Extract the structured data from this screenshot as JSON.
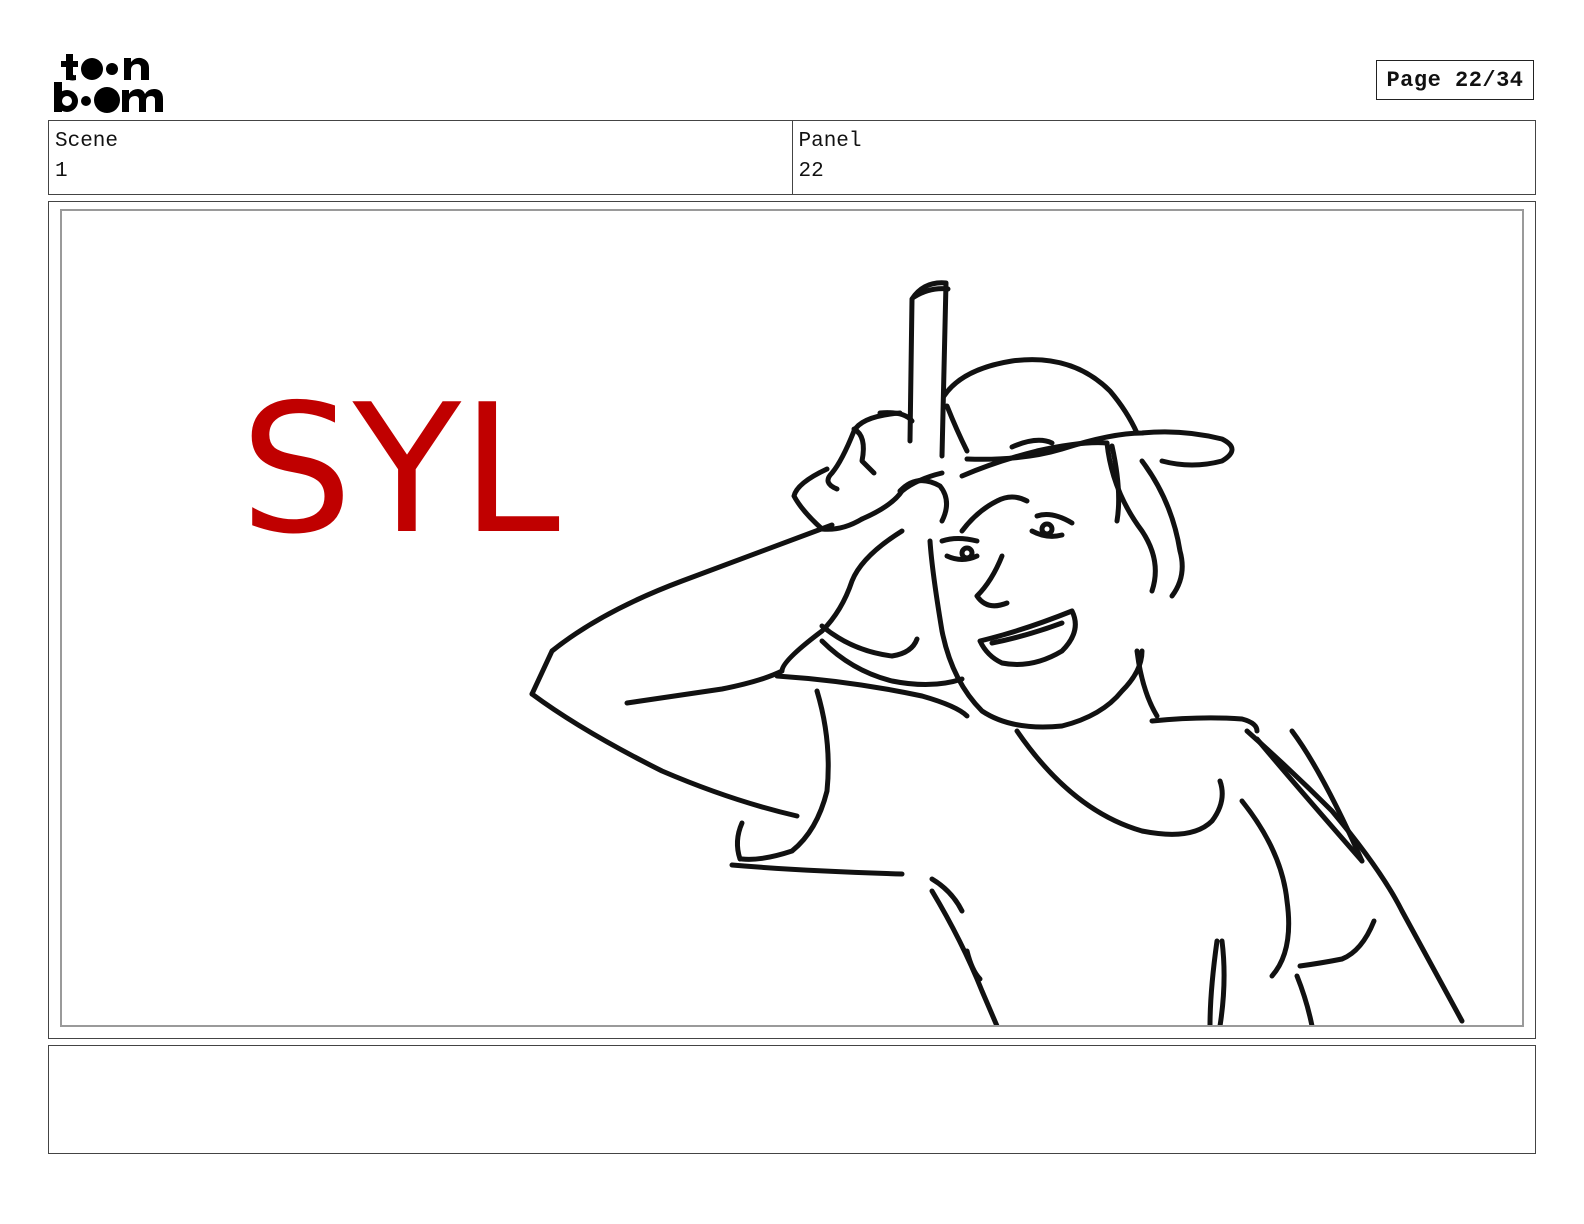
{
  "brand": {
    "logo_text": "toon boom",
    "logo_icon": "toon-boom-logo"
  },
  "page": {
    "label": "Page 22/34"
  },
  "scene": {
    "label": "Scene",
    "value": "1"
  },
  "panel": {
    "label": "Panel",
    "value": "22"
  },
  "drawing": {
    "caption": "SYL",
    "caption_color": "#c00000",
    "line_color": "#111111"
  },
  "notes": {
    "text": ""
  }
}
